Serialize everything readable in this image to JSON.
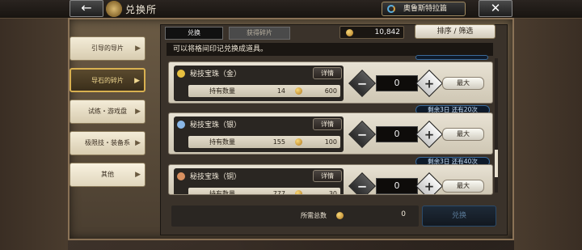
{
  "header": {
    "back_label": "←",
    "title": "兑换所",
    "world_label": "奥鲁斯特拉篇",
    "close_label": "✕"
  },
  "tabs": [
    {
      "label": "兑换",
      "active": true
    },
    {
      "label": "获得碎片",
      "active": false
    }
  ],
  "currency": {
    "value": "10,842",
    "icon": "coin-icon"
  },
  "sort_label": "排序 / 筛选",
  "description": "可以将格间印记兑换成道具。",
  "sidebar": {
    "items": [
      {
        "label": "引导的导片",
        "active": false
      },
      {
        "label": "导石的碎片",
        "active": true
      },
      {
        "label": "试练・游戏盘",
        "active": false
      },
      {
        "label": "极限技・装备系",
        "active": false
      },
      {
        "label": "其他",
        "active": false
      }
    ]
  },
  "items": [
    {
      "name": "秘技宝珠（金）",
      "icon_color": "#e8c040",
      "detail_label": "详情",
      "owned_label": "持有数量",
      "owned": "14",
      "price": "600",
      "qty": "0",
      "max_label": "最大",
      "remain": ""
    },
    {
      "name": "秘技宝珠（银）",
      "icon_color": "#8ab8e8",
      "detail_label": "详情",
      "owned_label": "持有数量",
      "owned": "155",
      "price": "100",
      "qty": "0",
      "max_label": "最大",
      "remain": "剩余3日 还有20次"
    },
    {
      "name": "秘技宝珠（铜）",
      "icon_color": "#d89060",
      "detail_label": "详情",
      "owned_label": "持有数量",
      "owned": "777",
      "price": "30",
      "qty": "0",
      "max_label": "最大",
      "remain": "剩余3日 还有40次"
    }
  ],
  "footer": {
    "total_label": "所需总数",
    "total_value": "0",
    "exchange_label": "兑换"
  }
}
